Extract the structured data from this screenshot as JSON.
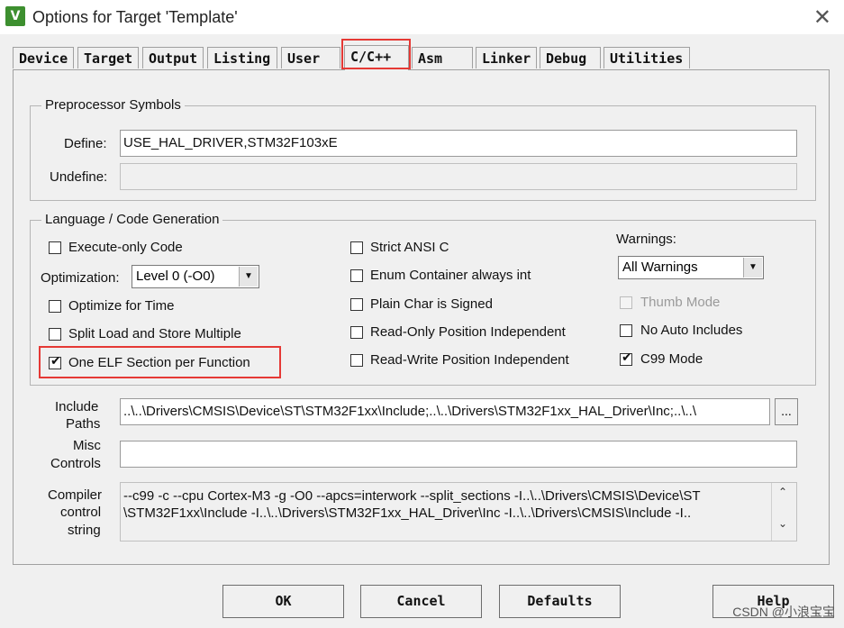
{
  "window": {
    "title": "Options for Target 'Template'",
    "app_icon": "keil-uvision-icon",
    "close_glyph": "✕"
  },
  "tabs": [
    {
      "label": "Device"
    },
    {
      "label": "Target"
    },
    {
      "label": "Output"
    },
    {
      "label": "Listing"
    },
    {
      "label": "User"
    },
    {
      "label": "C/C++"
    },
    {
      "label": "Asm"
    },
    {
      "label": "Linker"
    },
    {
      "label": "Debug"
    },
    {
      "label": "Utilities"
    }
  ],
  "active_tab": "C/C++",
  "preprocessor": {
    "title": "Preprocessor Symbols",
    "define_label": "Define:",
    "define_value": "USE_HAL_DRIVER,STM32F103xE",
    "undefine_label": "Undefine:",
    "undefine_value": ""
  },
  "language": {
    "title": "Language / Code Generation",
    "col1": [
      {
        "label": "Execute-only Code",
        "checked": false
      },
      {
        "label": "Optimize for Time",
        "checked": false
      },
      {
        "label": "Split Load and Store Multiple",
        "checked": false
      },
      {
        "label": "One ELF Section per Function",
        "checked": true
      }
    ],
    "optimization_label": "Optimization:",
    "optimization_value": "Level 0 (-O0)",
    "col2": [
      {
        "label": "Strict ANSI C",
        "checked": false
      },
      {
        "label": "Enum Container always int",
        "checked": false
      },
      {
        "label": "Plain Char is Signed",
        "checked": false
      },
      {
        "label": "Read-Only Position Independent",
        "checked": false
      },
      {
        "label": "Read-Write Position Independent",
        "checked": false
      }
    ],
    "warnings_label": "Warnings:",
    "warnings_value": "All Warnings",
    "col3": [
      {
        "label": "Thumb Mode",
        "checked": false,
        "disabled": true
      },
      {
        "label": "No Auto Includes",
        "checked": false
      },
      {
        "label": "C99 Mode",
        "checked": true
      }
    ],
    "check_glyph": "✔",
    "dropdown_glyph": "▼"
  },
  "include": {
    "label_line1": "Include",
    "label_line2": "Paths",
    "value": "..\\..\\Drivers\\CMSIS\\Device\\ST\\STM32F1xx\\Include;..\\..\\Drivers\\STM32F1xx_HAL_Driver\\Inc;..\\..\\",
    "browse_label": "..."
  },
  "misc": {
    "label_line1": "Misc",
    "label_line2": "Controls",
    "value": ""
  },
  "compiler": {
    "label_line1": "Compiler",
    "label_line2": "control",
    "label_line3": "string",
    "line1": "--c99 -c --cpu Cortex-M3 -g -O0 --apcs=interwork --split_sections -I..\\..\\Drivers\\CMSIS\\Device\\ST",
    "line2": "\\STM32F1xx\\Include -I..\\..\\Drivers\\STM32F1xx_HAL_Driver\\Inc -I..\\..\\Drivers\\CMSIS\\Include -I..",
    "scroll_up": "⌃",
    "scroll_down": "⌄"
  },
  "buttons": {
    "ok": "OK",
    "cancel": "Cancel",
    "defaults": "Defaults",
    "help": "Help"
  },
  "watermark": "CSDN @小浪宝宝"
}
